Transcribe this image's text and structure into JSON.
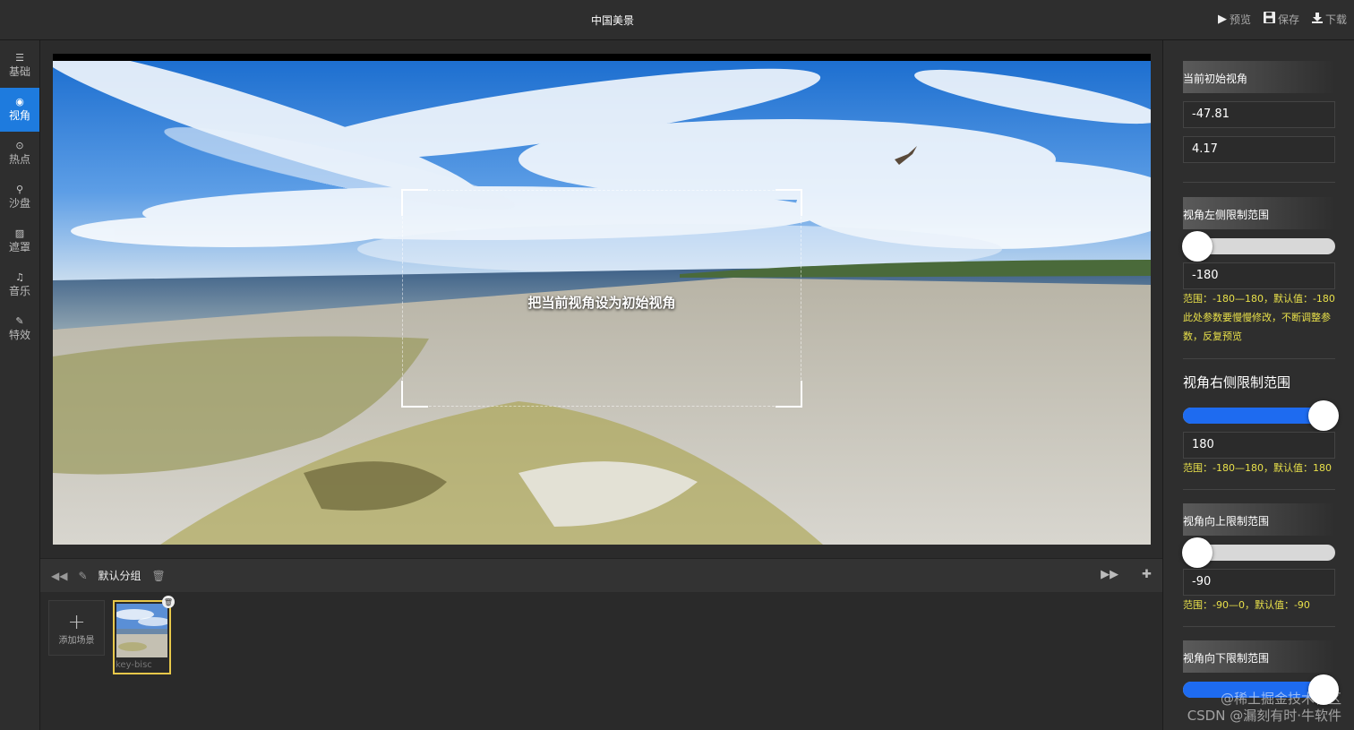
{
  "header": {
    "title": "中国美景",
    "actions": [
      {
        "icon": "play-icon",
        "label": "预览"
      },
      {
        "icon": "save-icon",
        "label": "保存"
      },
      {
        "icon": "download-icon",
        "label": "下载"
      }
    ]
  },
  "sidebar": {
    "items": [
      {
        "icon": "list-icon",
        "label": "基础",
        "active": false
      },
      {
        "icon": "eye-icon",
        "label": "视角",
        "active": true
      },
      {
        "icon": "target-icon",
        "label": "热点",
        "active": false
      },
      {
        "icon": "map-pin-icon",
        "label": "沙盘",
        "active": false
      },
      {
        "icon": "image-icon",
        "label": "遮罩",
        "active": false
      },
      {
        "icon": "music-icon",
        "label": "音乐",
        "active": false
      },
      {
        "icon": "magic-wand-icon",
        "label": "特效",
        "active": false
      }
    ]
  },
  "viewer": {
    "frame_label": "把当前视角设为初始视角"
  },
  "scene_bar": {
    "group_name": "默认分组"
  },
  "scenes": {
    "add_label": "添加场景",
    "items": [
      {
        "name": "key-bisc"
      }
    ]
  },
  "panel": {
    "initial_view": {
      "title": "当前初始视角",
      "horizontal": "-47.81",
      "vertical": "4.17"
    },
    "left_limit": {
      "title": "视角左侧限制范围",
      "value": "-180",
      "level": 0,
      "hint": "范围：-180—180，默认值：-180",
      "note": "此处参数要慢慢修改，不断调整参数，反复预览"
    },
    "right_limit": {
      "title": "视角右侧限制范围",
      "value": "180",
      "level": 1,
      "hint": "范围：-180—180，默认值：180"
    },
    "up_limit": {
      "title": "视角向上限制范围",
      "value": "-90",
      "level": 0,
      "hint": "范围：-90—0，默认值：-90"
    },
    "down_limit": {
      "title": "视角向下限制范围",
      "level": 1
    }
  },
  "watermark": {
    "line1": "@稀土掘金技术社区",
    "line2": "CSDN @漏刻有时·牛软件"
  },
  "colors": {
    "accent": "#1e7bde",
    "hint": "#e8e04a",
    "selected_border": "#e8c84a"
  }
}
